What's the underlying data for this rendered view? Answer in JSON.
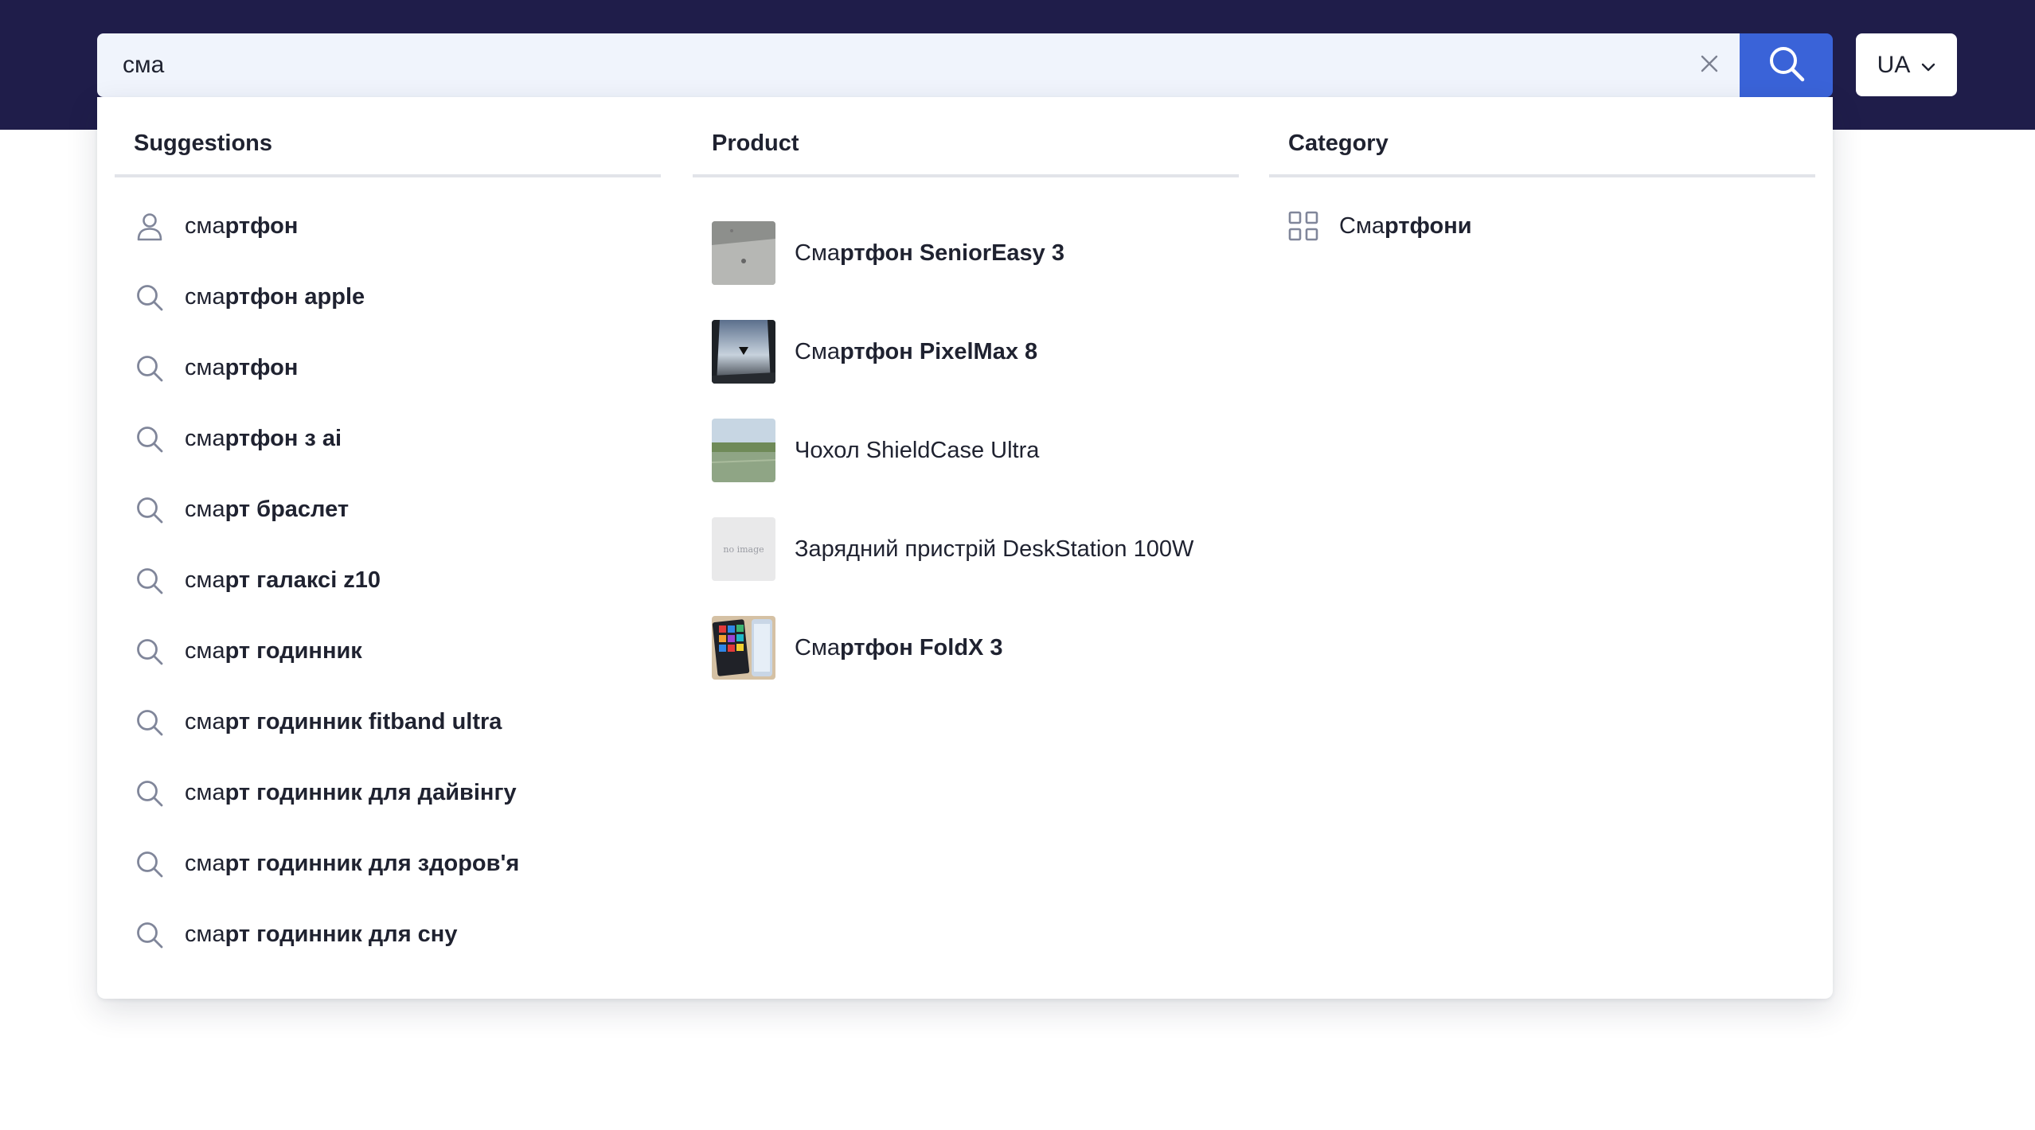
{
  "search": {
    "value": "сма",
    "placeholder": ""
  },
  "language": {
    "selected": "UA"
  },
  "columns": {
    "suggestions": {
      "title": "Suggestions",
      "items": [
        {
          "prefix": "сма",
          "rest": "ртфон",
          "icon": "user-icon"
        },
        {
          "prefix": "сма",
          "rest": "ртфон apple",
          "icon": "search-icon"
        },
        {
          "prefix": "сма",
          "rest": "ртфон",
          "icon": "search-icon"
        },
        {
          "prefix": "сма",
          "rest": "ртфон з ai",
          "icon": "search-icon"
        },
        {
          "prefix": "сма",
          "rest": "рт браслет",
          "icon": "search-icon"
        },
        {
          "prefix": "сма",
          "rest": "рт галаксі z10",
          "icon": "search-icon"
        },
        {
          "prefix": "сма",
          "rest": "рт годинник",
          "icon": "search-icon"
        },
        {
          "prefix": "сма",
          "rest": "рт годинник fitband ultra",
          "icon": "search-icon"
        },
        {
          "prefix": "сма",
          "rest": "рт годинник для дайвінгу",
          "icon": "search-icon"
        },
        {
          "prefix": "сма",
          "rest": "рт годинник для здоров'я",
          "icon": "search-icon"
        },
        {
          "prefix": "сма",
          "rest": "рт годинник для сну",
          "icon": "search-icon"
        }
      ]
    },
    "products": {
      "title": "Product",
      "items": [
        {
          "pre": "Сма",
          "bold": "ртфон SeniorEasy 3",
          "post": "",
          "thumb": "pavement-photo"
        },
        {
          "pre": "Сма",
          "bold": "ртфон PixelMax 8",
          "post": "",
          "thumb": "sky-photo"
        },
        {
          "pre": "Чохол ShieldCase Ultra",
          "bold": "",
          "post": "",
          "thumb": "lake-photo"
        },
        {
          "pre": "Зарядний пристрій DeskStation 100W",
          "bold": "",
          "post": "",
          "thumb": "no-image",
          "thumb_text": "no image"
        },
        {
          "pre": "Сма",
          "bold": "ртфон FoldX 3",
          "post": "",
          "thumb": "phone-photo"
        }
      ]
    },
    "categories": {
      "title": "Category",
      "items": [
        {
          "pre": "Сма",
          "bold": "ртфони",
          "icon": "grid-icon"
        }
      ]
    }
  },
  "colors": {
    "topbar": "#1f1d4a",
    "search_button": "#3a63d8",
    "search_field": "#f0f4fc"
  }
}
